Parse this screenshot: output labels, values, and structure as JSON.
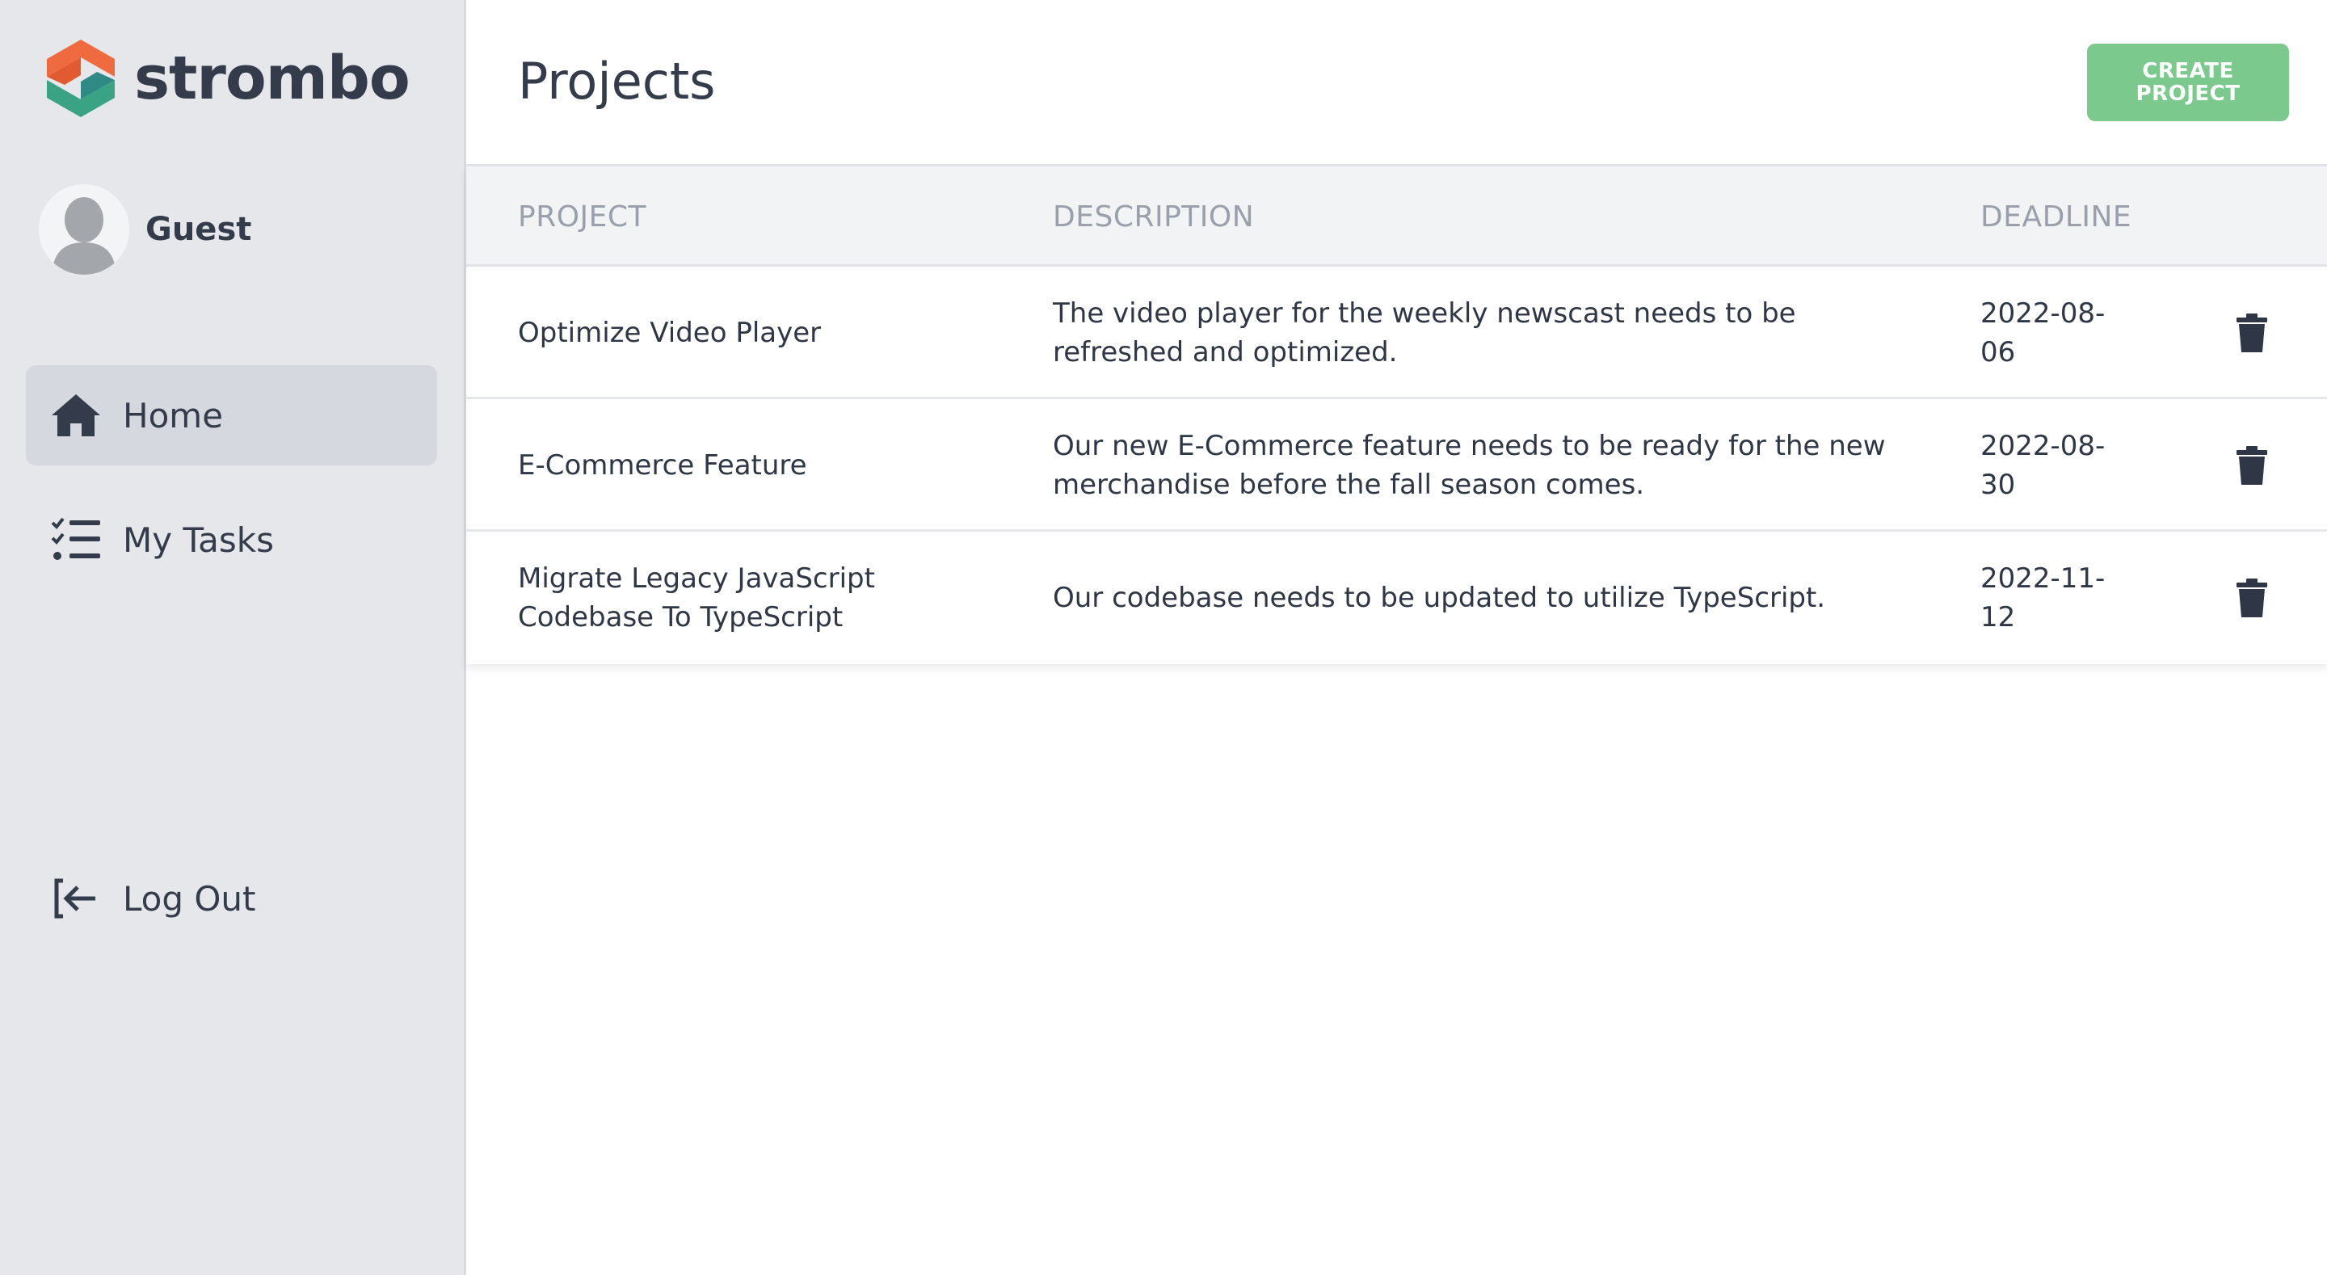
{
  "brand": {
    "name": "strombo",
    "logo_colors": [
      "#ef6b3f",
      "#3aa383",
      "#2f8a86"
    ]
  },
  "user": {
    "name": "Guest"
  },
  "nav": {
    "home": {
      "label": "Home",
      "icon": "home-icon"
    },
    "tasks": {
      "label": "My Tasks",
      "icon": "checklist-icon"
    },
    "logout": {
      "label": "Log Out",
      "icon": "logout-icon"
    }
  },
  "header": {
    "title": "Projects",
    "create_button": "CREATE\nPROJECT"
  },
  "table": {
    "columns": [
      "PROJECT",
      "DESCRIPTION",
      "DEADLINE"
    ],
    "rows": [
      {
        "project": "Optimize Video Player",
        "description": "The video player for the weekly newscast needs to be refreshed and optimized.",
        "deadline": "2022-08-06"
      },
      {
        "project": "E-Commerce Feature",
        "description": "Our new E-Commerce feature needs to be ready for the new merchandise before the fall season comes.",
        "deadline": "2022-08-30"
      },
      {
        "project": "Migrate Legacy JavaScript Codebase To TypeScript",
        "description": "Our codebase needs to be updated to utilize TypeScript.",
        "deadline": "2022-11-12"
      }
    ]
  },
  "colors": {
    "accent": "#7cc98e",
    "sidebar": "#e5e7eb",
    "text": "#2f3645"
  }
}
